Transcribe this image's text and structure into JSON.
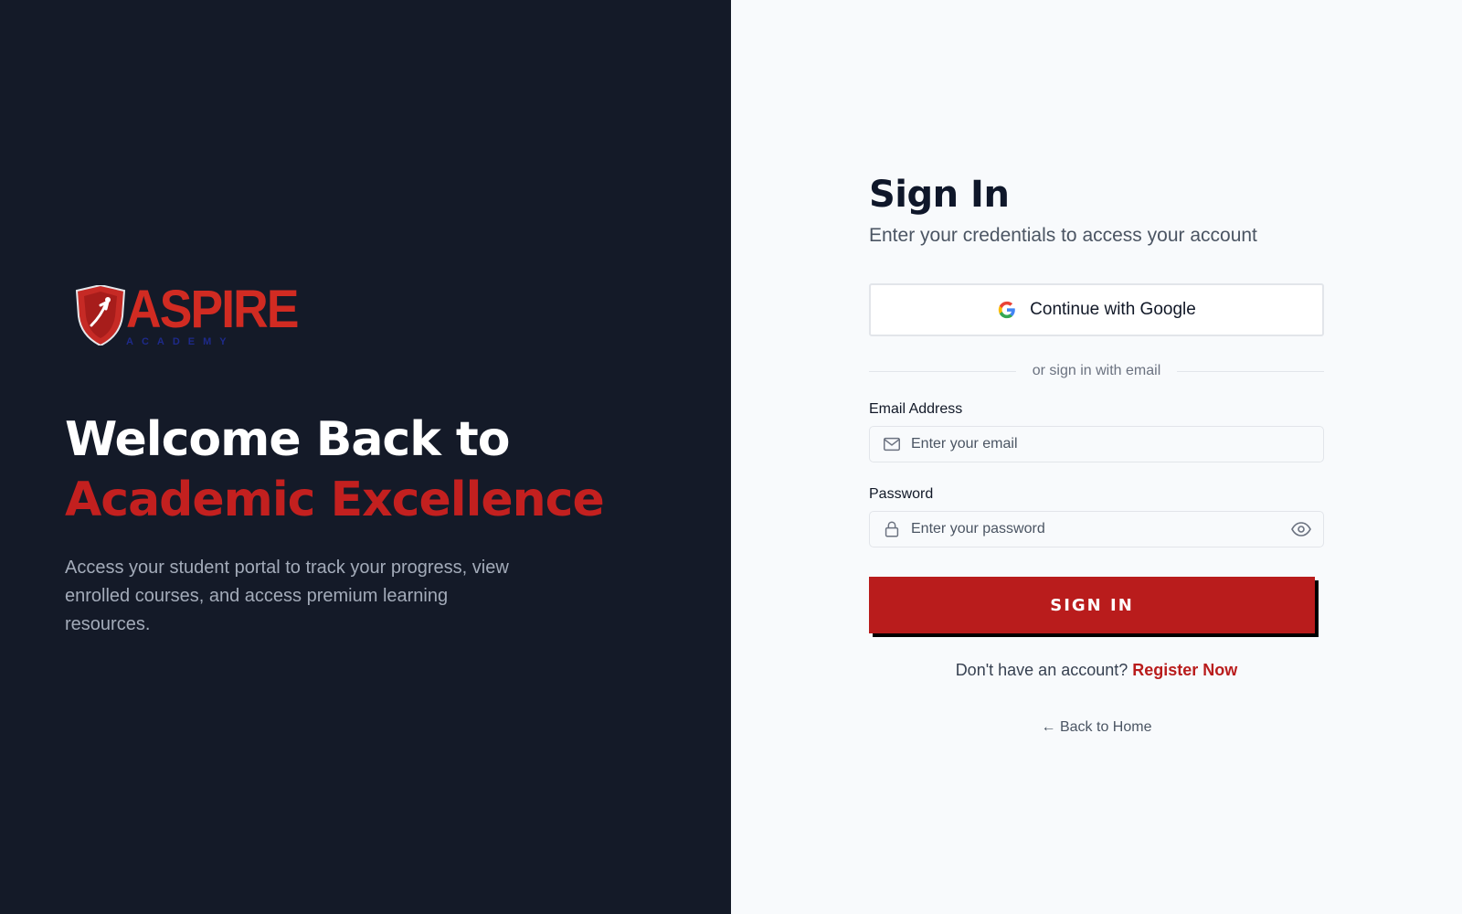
{
  "brand": {
    "logo_word": "ASPIRE",
    "logo_sub": "ACADEMY",
    "accent_color": "#b91c1c",
    "dark_bg": "#141a28"
  },
  "hero": {
    "title_line1": "Welcome Back to",
    "title_line2": "Academic Excellence",
    "description": "Access your student portal to track your progress, view enrolled courses, and access premium learning resources."
  },
  "form": {
    "title": "Sign In",
    "subtitle": "Enter your credentials to access your account",
    "google_label": "Continue with Google",
    "divider_text": "or sign in with email",
    "email_label": "Email Address",
    "email_placeholder": "Enter your email",
    "email_value": "",
    "password_label": "Password",
    "password_placeholder": "Enter your password",
    "password_value": "",
    "submit_label": "SIGN IN",
    "register_prompt": "Don't have an account?",
    "register_link": "Register Now",
    "back_home": "← Back to Home"
  },
  "icons": {
    "google": "google-icon",
    "email": "mail-icon",
    "password": "lock-icon",
    "toggle_visibility": "eye-icon",
    "logo": "shield-icon"
  }
}
